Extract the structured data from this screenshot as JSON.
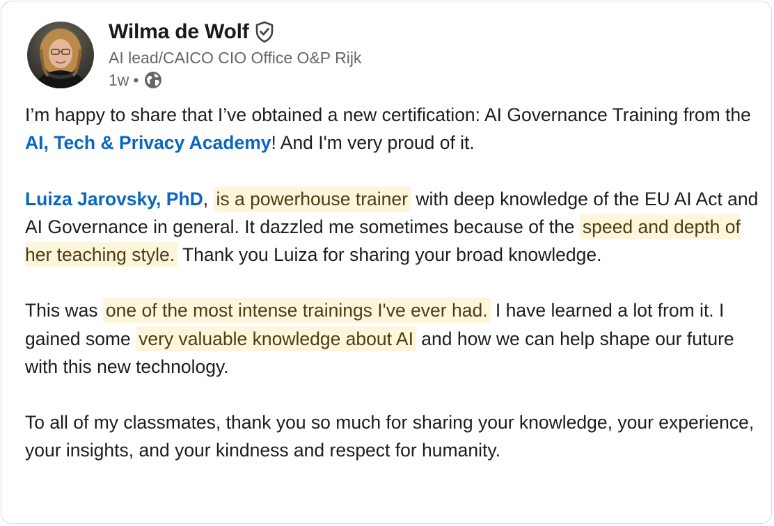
{
  "author": {
    "name": "Wilma de Wolf",
    "headline": "AI lead/CAICO CIO Office O&P Rijk",
    "time": "1w",
    "separator": "•",
    "verified_icon": "shield-check-icon",
    "visibility_icon": "globe-icon"
  },
  "colors": {
    "link": "#0a66c2",
    "highlight": "#fdf6dc",
    "secondary_text": "#666666"
  },
  "post": {
    "p1": {
      "t1": "I’m happy to share that I’ve obtained a new certification: AI Governance Training from the ",
      "link": "AI, Tech & Privacy Academy",
      "t2": "! And I'm very proud of it."
    },
    "p2": {
      "mention": "Luiza Jarovsky, PhD",
      "t1": ", ",
      "hl1": "is a powerhouse trainer",
      "t2": " with deep knowledge of the EU AI Act and AI Governance in general. It dazzled me sometimes because of the ",
      "hl2": "speed and depth of her teaching style.",
      "t3": " Thank you Luiza for sharing your broad knowledge."
    },
    "p3": {
      "t1": "This was ",
      "hl1": "one of the most intense trainings I've ever had.",
      "t2": " I have learned a lot from it. I gained some ",
      "hl2": "very valuable knowledge about AI",
      "t3": " and how we can help shape our future with this new technology."
    },
    "p4": {
      "t1": "To all of my classmates, thank you so much for sharing your knowledge, your experience, your insights, and your kindness and respect for humanity."
    }
  }
}
